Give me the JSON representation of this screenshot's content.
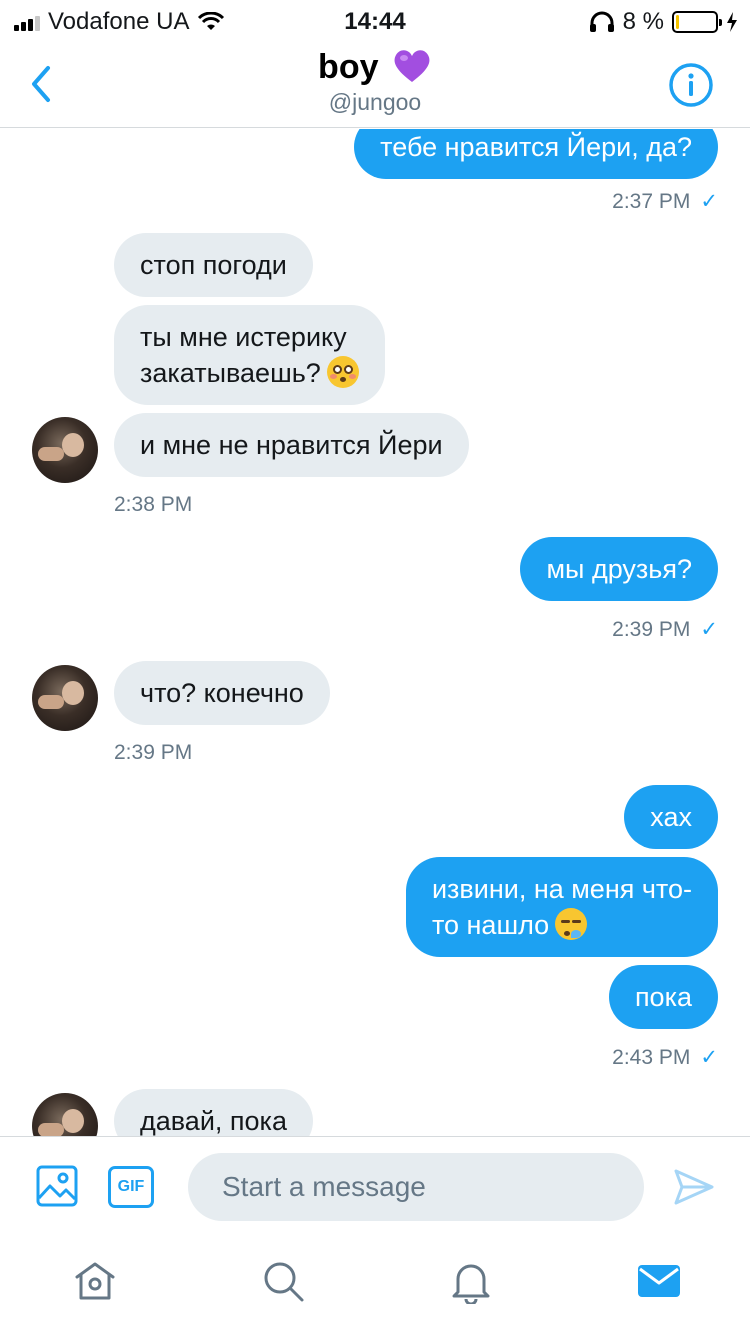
{
  "status_bar": {
    "carrier": "Vodafone UA",
    "time": "14:44",
    "battery_percent": "8 %",
    "battery_level": 0.08
  },
  "header": {
    "title": "boy",
    "handle": "@jungoo"
  },
  "messages": [
    {
      "side": "out",
      "text": "тебе нравится Йери, да?"
    },
    {
      "side": "out",
      "stamp": "2:37 PM"
    },
    {
      "side": "in",
      "text": "стоп погоди"
    },
    {
      "side": "in",
      "line1": "ты мне истерику",
      "line2": "закатываешь?",
      "emoji": "flushed-face-emoji"
    },
    {
      "side": "in",
      "text": "и мне не нравится Йери"
    },
    {
      "side": "in",
      "stamp": "2:38 PM"
    },
    {
      "side": "out",
      "text": "мы друзья?"
    },
    {
      "side": "out",
      "stamp": "2:39 PM"
    },
    {
      "side": "in",
      "text": "что? конечно"
    },
    {
      "side": "in",
      "stamp": "2:39 PM"
    },
    {
      "side": "out",
      "text": "хах"
    },
    {
      "side": "out",
      "line1": "извини, на меня что-",
      "line2": "то нашло",
      "emoji": "sleepy-face-emoji"
    },
    {
      "side": "out",
      "text": "пока"
    },
    {
      "side": "out",
      "stamp": "2:43 PM"
    },
    {
      "side": "in",
      "text": "давай, пока"
    }
  ],
  "check_mark": "✓",
  "composer": {
    "gif_label": "GIF",
    "placeholder": "Start a message"
  },
  "tabs": [
    "home-icon",
    "search-icon",
    "notifications-icon",
    "messages-icon"
  ],
  "colors": {
    "accent": "#1da1f2",
    "incoming_bubble": "#e6ecf0",
    "secondary_text": "#657786"
  }
}
